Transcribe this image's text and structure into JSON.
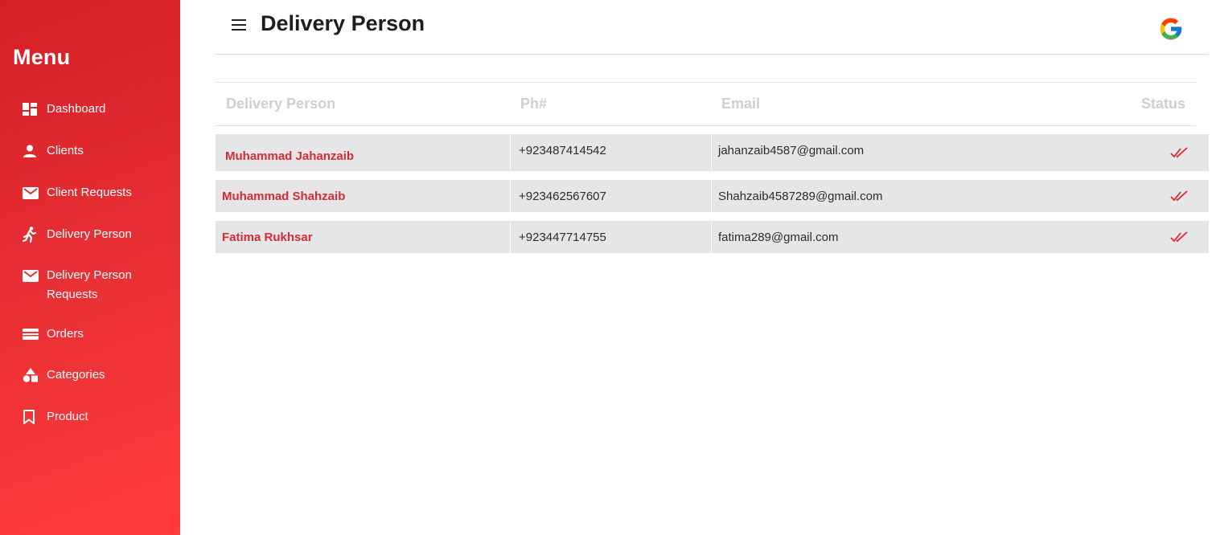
{
  "sidebar": {
    "title": "Menu",
    "items": [
      {
        "label": "Dashboard",
        "icon": "dashboard-icon"
      },
      {
        "label": "Clients",
        "icon": "person-icon"
      },
      {
        "label": "Client Requests",
        "icon": "mail-icon"
      },
      {
        "label": "Delivery Person",
        "icon": "runner-icon"
      },
      {
        "label_line1": "Delivery Person",
        "label_line2": "Requests",
        "icon": "mail-icon"
      },
      {
        "label": "Orders",
        "icon": "card-icon"
      },
      {
        "label": "Categories",
        "icon": "shapes-icon"
      },
      {
        "label": "Product",
        "icon": "bookmark-icon"
      }
    ]
  },
  "header": {
    "title": "Delivery Person",
    "menu_icon": "hamburger-icon",
    "account_icon": "google-icon"
  },
  "table": {
    "columns": [
      "Delivery Person",
      "Ph#",
      "Email",
      "Status"
    ],
    "rows": [
      {
        "name": "Muhammad Jahanzaib",
        "phone": "+923487414542",
        "email": "jahanzaib4587@gmail.com",
        "status": "double-check-icon"
      },
      {
        "name": "Muhammad Shahzaib",
        "phone": "+923462567607",
        "email": "Shahzaib4587289@gmail.com",
        "status": "double-check-icon"
      },
      {
        "name": "Fatima Rukhsar",
        "phone": "+923447714755",
        "email": "fatima289@gmail.com",
        "status": "double-check-icon"
      }
    ]
  },
  "colors": {
    "sidebar_start": "#d41f25",
    "sidebar_end": "#ff3b3b",
    "accent_text": "#d62b33",
    "row_background": "#e6e6e8"
  }
}
